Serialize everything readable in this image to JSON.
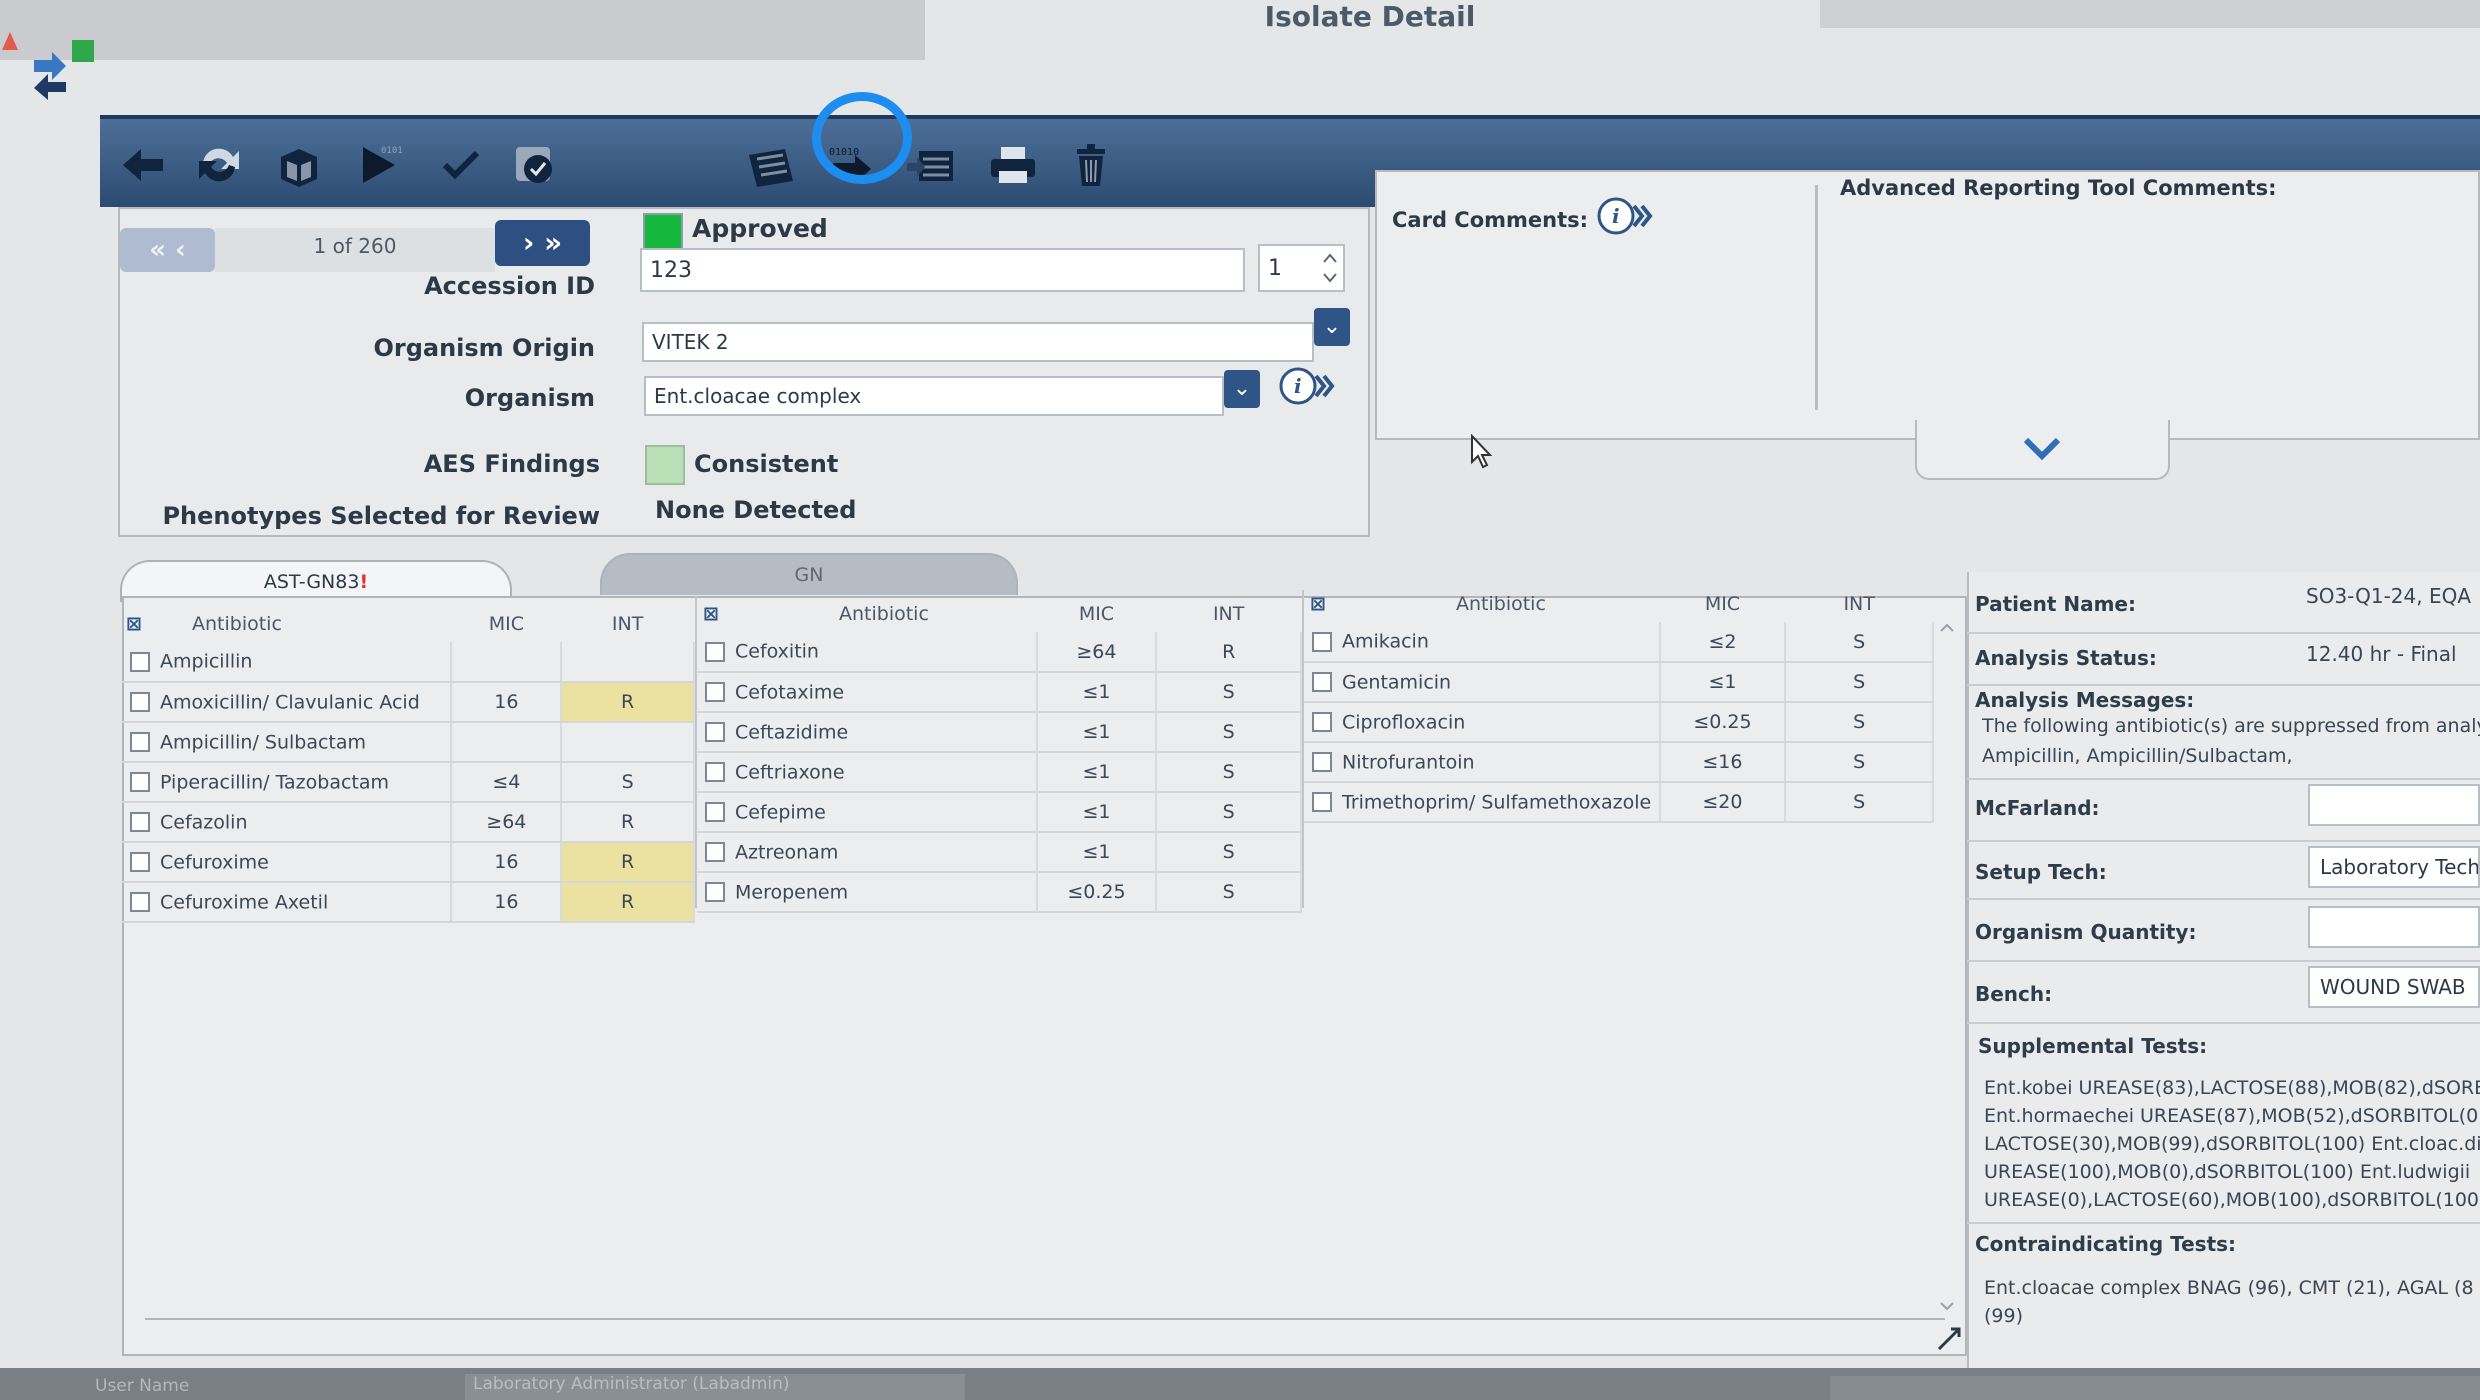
{
  "window": {
    "title": "Isolate Detail"
  },
  "navigation": {
    "record_position": "1 of 260",
    "prev_label": "« ‹",
    "next_label": "› »"
  },
  "status": {
    "label": "Approved",
    "color": "#15b83c"
  },
  "form": {
    "accession_id_label": "Accession ID",
    "accession_id_value": "123",
    "accession_spin_value": "1",
    "organism_origin_label": "Organism Origin",
    "organism_origin_value": "VITEK 2",
    "organism_label": "Organism",
    "organism_value": "Ent.cloacae complex",
    "aes_findings_label": "AES Findings",
    "aes_findings_value": "Consistent",
    "phenotypes_label": "Phenotypes Selected for Review",
    "phenotypes_value": "None Detected"
  },
  "comments": {
    "card_comments_label": "Card Comments:",
    "advanced_comments_label": "Advanced Reporting Tool Comments:"
  },
  "tabs": [
    {
      "label": "AST-GN83",
      "alert": "!",
      "active": true
    },
    {
      "label": "GN",
      "active": false
    }
  ],
  "grid_headers": {
    "antibiotic": "Antibiotic",
    "mic": "MIC",
    "int": "INT"
  },
  "antibiotics": {
    "column1": [
      {
        "name": "Ampicillin",
        "mic": "",
        "int": ""
      },
      {
        "name": "Amoxicillin/ Clavulanic Acid",
        "mic": "16",
        "int": "R"
      },
      {
        "name": "Ampicillin/ Sulbactam",
        "mic": "",
        "int": ""
      },
      {
        "name": "Piperacillin/ Tazobactam",
        "mic": "≤4",
        "int": "S"
      },
      {
        "name": "Cefazolin",
        "mic": "≥64",
        "int": "R"
      },
      {
        "name": "Cefuroxime",
        "mic": "16",
        "int": "R"
      },
      {
        "name": "Cefuroxime Axetil",
        "mic": "16",
        "int": "R"
      }
    ],
    "column2": [
      {
        "name": "Cefoxitin",
        "mic": "≥64",
        "int": "R"
      },
      {
        "name": "Cefotaxime",
        "mic": "≤1",
        "int": "S"
      },
      {
        "name": "Ceftazidime",
        "mic": "≤1",
        "int": "S"
      },
      {
        "name": "Ceftriaxone",
        "mic": "≤1",
        "int": "S"
      },
      {
        "name": "Cefepime",
        "mic": "≤1",
        "int": "S"
      },
      {
        "name": "Aztreonam",
        "mic": "≤1",
        "int": "S"
      },
      {
        "name": "Meropenem",
        "mic": "≤0.25",
        "int": "S"
      }
    ],
    "column3": [
      {
        "name": "Amikacin",
        "mic": "≤2",
        "int": "S"
      },
      {
        "name": "Gentamicin",
        "mic": "≤1",
        "int": "S"
      },
      {
        "name": "Ciprofloxacin",
        "mic": "≤0.25",
        "int": "S"
      },
      {
        "name": "Nitrofurantoin",
        "mic": "≤16",
        "int": "S"
      },
      {
        "name": "Trimethoprim/ Sulfamethoxazole",
        "mic": "≤20",
        "int": "S"
      }
    ]
  },
  "patient_info": {
    "patient_name_label": "Patient Name:",
    "patient_name_value": "SO3-Q1-24, EQA",
    "analysis_status_label": "Analysis Status:",
    "analysis_status_value": "12.40 hr - Final",
    "analysis_messages_label": "Analysis Messages:",
    "analysis_messages_lines": [
      "The following antibiotic(s) are suppressed from analy",
      "Ampicillin, Ampicillin/Sulbactam,"
    ],
    "mcfarland_label": "McFarland:",
    "mcfarland_value": "",
    "setup_tech_label": "Setup Tech:",
    "setup_tech_value": "Laboratory Tech",
    "organism_quantity_label": "Organism Quantity:",
    "organism_quantity_value": "",
    "bench_label": "Bench:",
    "bench_value": "WOUND SWAB",
    "supplemental_tests_label": "Supplemental Tests:",
    "supplemental_tests_lines": [
      "Ent.kobei UREASE(83),LACTOSE(88),MOB(82),dSORE",
      "Ent.hormaechei UREASE(87),MOB(52),dSORBITOL(0)",
      "LACTOSE(30),MOB(99),dSORBITOL(100) Ent.cloac.di",
      "UREASE(100),MOB(0),dSORBITOL(100) Ent.ludwigii",
      "UREASE(0),LACTOSE(60),MOB(100),dSORBITOL(100"
    ],
    "contraindicating_tests_label": "Contraindicating Tests:",
    "contraindicating_tests_lines": [
      "Ent.cloacae complex   BNAG (96), CMT (21), AGAL (8",
      "(99)"
    ]
  },
  "status_bar": {
    "user_name_label": "User Name",
    "user_name_value": "Laboratory Administrator (Labadmin)"
  },
  "colors": {
    "toolbar": "#2c4b72",
    "highlight_ring": "#1d8ef0",
    "resistant_flag": "#ebe2a1",
    "consistent_swatch": "#b9e0b6"
  },
  "icons": [
    "back-arrow-icon",
    "refresh-icon",
    "cube-grid-icon",
    "play-binary-icon",
    "checkmark-icon",
    "verify-badge-icon",
    "card-grid-icon",
    "binary-export-icon",
    "card-export-icon",
    "printer-icon",
    "trash-icon",
    "info-icon",
    "chevron-down-icon"
  ]
}
